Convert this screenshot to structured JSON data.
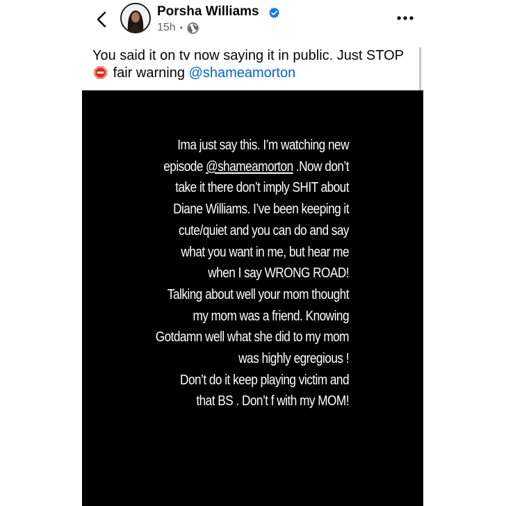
{
  "post": {
    "author_name": "Porsha Williams",
    "timestamp": "15h",
    "separator": "•",
    "privacy": "globe-icon"
  },
  "caption": {
    "part1": "You said it on tv now saying it in public. Just STOP",
    "part2": "fair warning",
    "mention": "@shameamorton",
    "emoji": "stop-sign-emoji"
  },
  "story": {
    "lines": [
      "Ima just say this. I’m watching new",
      "episode",
      "@shameamorton",
      ".Now don’t",
      "take it there don’t imply SHIT about",
      "Diane Williams. I’ve been keeping it",
      "cute/quiet and you can do and say",
      "what you want in me, but hear me",
      "when I say WRONG ROAD!",
      "Talking about well your mom thought",
      "my mom was a friend. Knowing",
      "Gotdamn well what she did to my mom",
      "was highly egregious !",
      "Don’t do it keep playing victim and",
      "that BS . Don’t f with my MOM!"
    ]
  },
  "colors": {
    "link": "#0064d1",
    "verified": "#1877f2",
    "story_bg": "#000000",
    "meta_text": "#65676b"
  }
}
